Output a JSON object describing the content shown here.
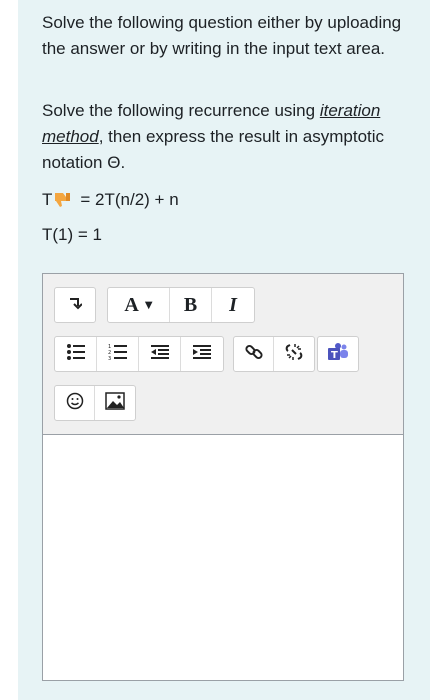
{
  "question": {
    "intro": "Solve the following question either by uploading the answer or by writing in the input text area.",
    "prompt_before_link": "Solve the following recurrence using ",
    "prompt_link": "iteration method",
    "prompt_after_link": ", then express the result in asymptotic notation Θ.",
    "equation1_left": "T",
    "equation1_right": "= 2T(n/2) + n",
    "equation2": "T(1) = 1"
  },
  "toolbar": {
    "format_label": "A",
    "bold_label": "B",
    "italic_label": "I",
    "icons": [
      "collapse-icon",
      "paragraph-format-icon",
      "bold-icon",
      "italic-icon",
      "unordered-list-icon",
      "ordered-list-icon",
      "outdent-icon",
      "indent-icon",
      "link-icon",
      "unlink-icon",
      "teams-icon",
      "emoji-icon",
      "image-icon"
    ]
  },
  "colors": {
    "panel_background": "#e7f3f5",
    "toolbar_background": "#f0f0f0",
    "teams_purple": "#5059c9",
    "thumb_orange": "#f4a640"
  },
  "answer_area": {
    "value": ""
  }
}
